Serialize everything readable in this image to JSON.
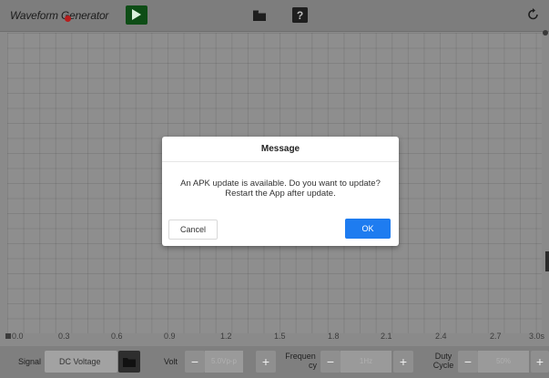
{
  "toolbar": {
    "title": "Waveform Generator",
    "icons": [
      "play-icon",
      "folder-icon",
      "help-icon",
      "refresh-icon"
    ]
  },
  "axis": {
    "ticks": [
      "0.0",
      "0.3",
      "0.6",
      "0.9",
      "1.2",
      "1.5",
      "1.8",
      "2.1",
      "2.4",
      "2.7",
      "3.0s"
    ]
  },
  "controls": {
    "signal_label": "Signal",
    "signal_value": "DC Voltage",
    "volt_label": "Volt",
    "volt_value": "5.0Vp-p",
    "frequency_label_1": "Frequen",
    "frequency_label_2": "cy",
    "frequency_value": "1Hz",
    "duty_label_1": "Duty",
    "duty_label_2": "Cycle",
    "duty_value": "50%",
    "minus": "−",
    "plus": "+"
  },
  "dialog": {
    "title": "Message",
    "message_line1": "An APK update is available. Do you want to update?",
    "message_line2": "Restart the App after update.",
    "cancel_label": "Cancel",
    "ok_label": "OK"
  },
  "colors": {
    "accent": "#1e7cf0",
    "play_button": "#0e4d16",
    "title_dot": "#b71c1c"
  }
}
